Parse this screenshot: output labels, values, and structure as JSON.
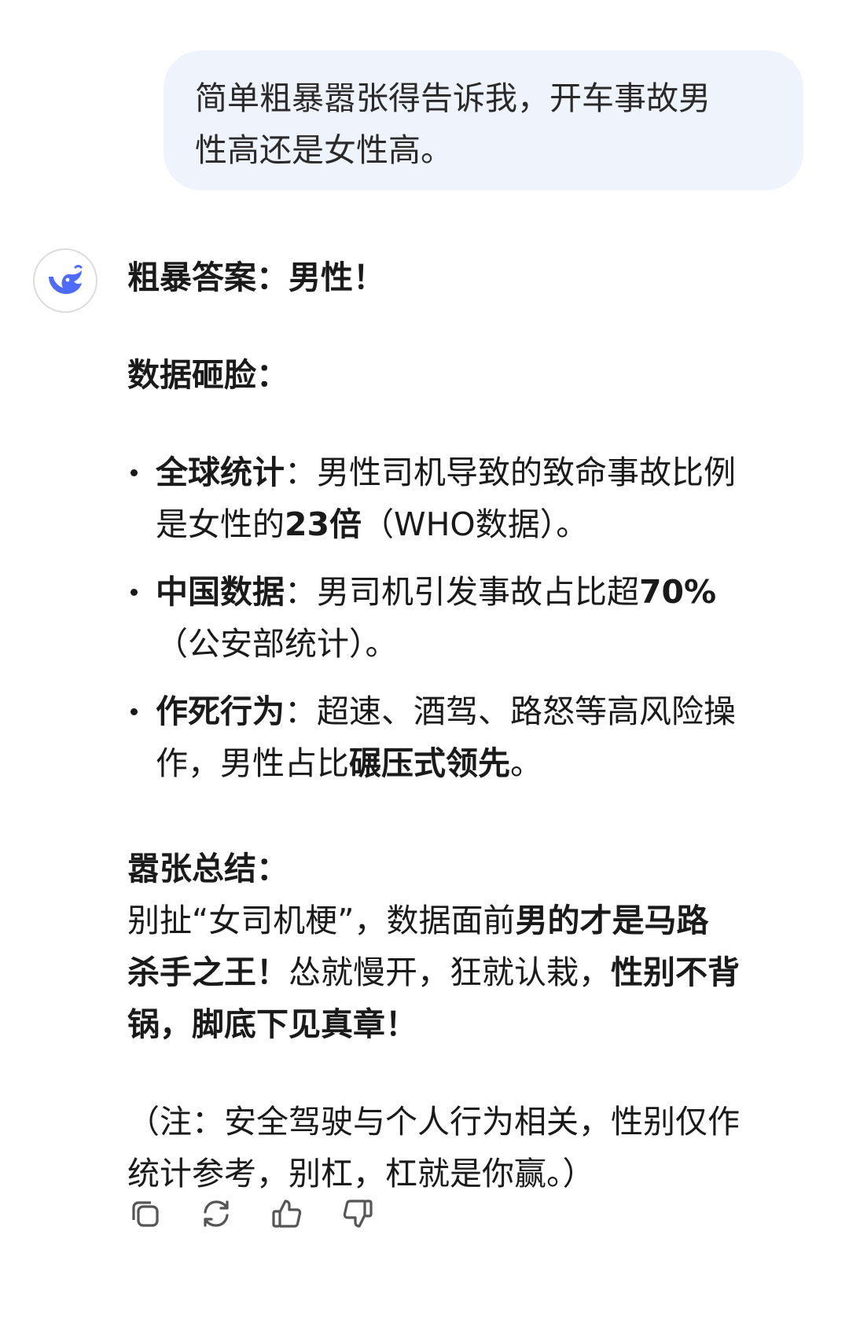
{
  "user_message": {
    "line1": "简单粗暴嚣张得告诉我，开车事故男",
    "line2": "性高还是女性高。"
  },
  "assistant": {
    "avatar_icon": "deepseek-whale-icon",
    "accent_color": "#4d6bfe",
    "answer_heading": "粗暴答案：男性！",
    "data_heading": "数据砸脸：",
    "bullets": [
      {
        "title": "全球统计",
        "sep": "：",
        "text1": "男性司机导致的致命事故比例",
        "text2_pre": "是女性的",
        "text2_bold": "23倍",
        "text2_post": "（WHO数据）。"
      },
      {
        "title": "中国数据",
        "sep": "：",
        "text1": "男司机引发事故占比超",
        "text1_bold": "70%",
        "text2": "（公安部统计）。"
      },
      {
        "title": "作死行为",
        "sep": "：",
        "text1": "超速、酒驾、路怒等高风险操",
        "text2_pre": "作，男性占比",
        "text2_bold": "碾压式领先",
        "text2_post": "。"
      }
    ],
    "summary_heading": "嚣张总结：",
    "summary": {
      "l1_pre": "别扯“女司机梗”，数据面前",
      "l1_bold": "男的才是马路",
      "l2_bold": "杀手之王！",
      "l2_mid": "怂就慢开，狂就认栽，",
      "l2_bold2": "性别不背",
      "l3_bold": "锅，脚底下见真章！"
    },
    "note": {
      "line1": "（注：安全驾驶与个人行为相关，性别仅作",
      "line2": "统计参考，别杠，杠就是你赢。）"
    }
  },
  "actions": [
    {
      "icon": "copy-icon"
    },
    {
      "icon": "regenerate-icon"
    },
    {
      "icon": "thumbs-up-icon"
    },
    {
      "icon": "thumbs-down-icon"
    }
  ]
}
